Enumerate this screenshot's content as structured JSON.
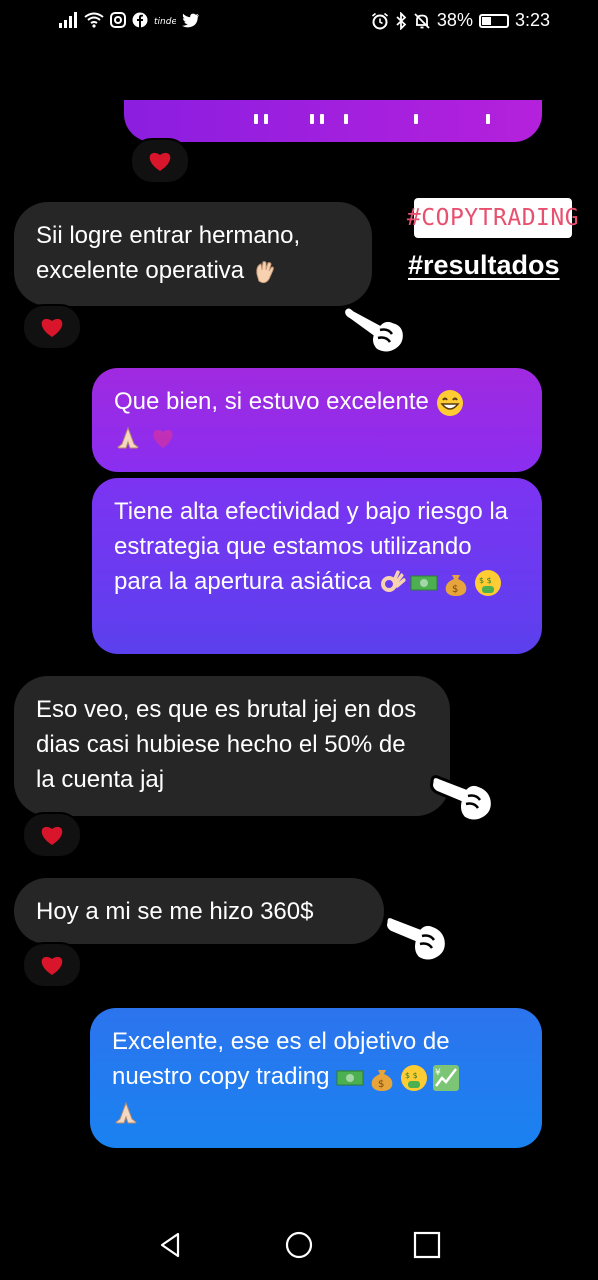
{
  "status_bar": {
    "battery_text": "38%",
    "battery_level": 0.38,
    "time": "3:23",
    "left_icons": [
      "signal-icon",
      "wifi-icon",
      "instagram-icon",
      "facebook-icon",
      "tinder-icon",
      "twitter-icon"
    ],
    "right_icons": [
      "alarm-icon",
      "bluetooth-icon",
      "mute-icon",
      "battery-icon"
    ]
  },
  "sticker": {
    "tag": "#COPYTRADING",
    "text": "#resultados"
  },
  "messages": [
    {
      "side": "in",
      "text": "Sii logre entrar hermano, excelente operativa",
      "emoji": [
        "wave"
      ],
      "reaction": "heart"
    },
    {
      "side": "out",
      "text": "Que bien, si estuvo excelente",
      "emoji": [
        "grin",
        "pray",
        "sparkle-heart"
      ]
    },
    {
      "side": "out",
      "text": "Tiene alta efectividad y bajo riesgo la estrategia que estamos utilizando para la apertura asiática",
      "emoji": [
        "ok",
        "dollar",
        "moneybag",
        "money-face"
      ]
    },
    {
      "side": "in",
      "text": "Eso veo, es que es brutal jej en dos dias casi hubiese hecho el 50% de la cuenta jaj",
      "reaction": "heart"
    },
    {
      "side": "in",
      "text": "Hoy a mi se me hizo 360$",
      "reaction": "heart"
    },
    {
      "side": "out",
      "text": "Excelente, ese es el objetivo de nuestro copy trading",
      "emoji": [
        "dollar",
        "moneybag",
        "money-face",
        "chart",
        "pray"
      ]
    }
  ],
  "colors": {
    "incoming_bubble": "#262626",
    "outgoing_purple": "#a02ae0",
    "outgoing_violet": "#6b3af0",
    "outgoing_blue": "#1e7cf0",
    "heart": "#d9152b",
    "tag_text": "#e7506e"
  },
  "nav": [
    "back-icon",
    "home-icon",
    "recents-icon"
  ]
}
